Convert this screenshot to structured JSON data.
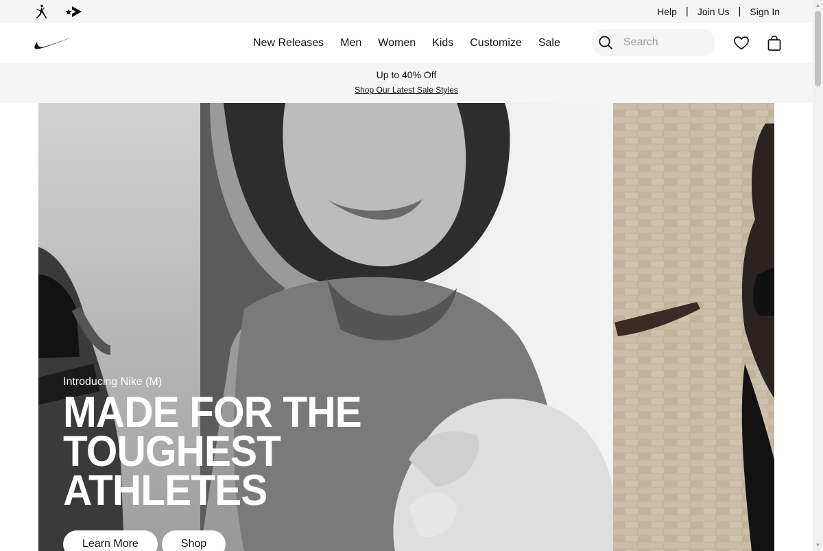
{
  "utility_bar": {
    "brand_icons": [
      "jordan-jumpman-icon",
      "converse-icon"
    ],
    "links": [
      "Help",
      "Join Us",
      "Sign In"
    ],
    "separator": "|"
  },
  "nav": {
    "logo_icon": "nike-swoosh-icon",
    "menu": [
      "New Releases",
      "Men",
      "Women",
      "Kids",
      "Customize",
      "Sale"
    ],
    "search": {
      "placeholder": "Search",
      "icon": "search-icon"
    },
    "favorites_icon": "heart-icon",
    "bag_icon": "bag-icon"
  },
  "promo": {
    "headline": "Up to 40% Off",
    "link": "Shop Our Latest Sale Styles"
  },
  "hero": {
    "eyebrow": "Introducing Nike (M)",
    "title_lines": [
      "MADE FOR THE",
      "TOUGHEST",
      "ATHLETES"
    ],
    "buttons": [
      "Learn More",
      "Shop"
    ]
  },
  "colors": {
    "text": "#111111",
    "bar_background": "#f5f5f5",
    "white": "#ffffff"
  }
}
